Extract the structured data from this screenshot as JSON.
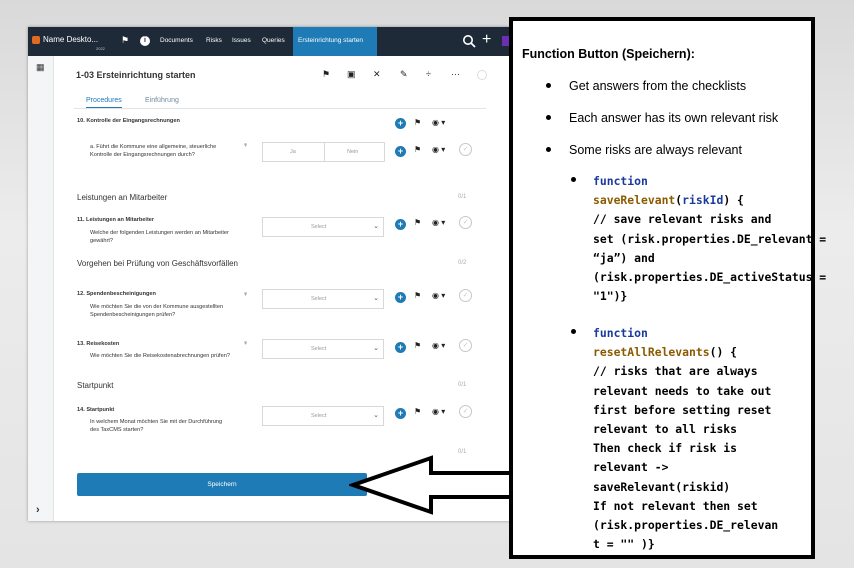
{
  "app": {
    "name": "Name Deskto...",
    "year": "2022",
    "nav": [
      "Documents",
      "Risks",
      "Issues",
      "Queries"
    ],
    "active_tab": "Ersteinrichtung starten"
  },
  "page": {
    "title": "1-03 Ersteinrichtung starten",
    "tabs": [
      "Procedures",
      "Einführung"
    ]
  },
  "questions": {
    "q10": {
      "title": "10. Kontrolle der Eingangsrechnungen"
    },
    "q10a": {
      "text": "a.  Führt die Kommune eine allgemeine, steuerliche Kontrolle der Eingangsrechnungen durch?",
      "yes": "Ja",
      "no": "Nein"
    },
    "sec1": {
      "title": "Leistungen an Mitarbeiter",
      "count": "0/1"
    },
    "q11": {
      "title": "11. Leistungen an Mitarbeiter",
      "text": "Welche der folgenden Leistungen werden an Mitarbeiter gewährt?",
      "select": "Select"
    },
    "sec2": {
      "title": "Vorgehen bei Prüfung von Geschäftsvorfällen",
      "count": "0/2"
    },
    "q12": {
      "title": "12. Spendenbescheinigungen",
      "text": "Wie möchten Sie die von der Kommune ausgestellten Spendenbescheinigungen prüfen?",
      "select": "Select"
    },
    "q13": {
      "title": "13. Reisekosten",
      "text": "Wie möchten Sie die Reisekostenabrechnungen prüfen?",
      "select": "Select"
    },
    "sec3": {
      "title": "Startpunkt",
      "count": "0/1"
    },
    "q14": {
      "title": "14. Startpunkt",
      "text": "In welchem Monat möchten Sie mit der Durchführung des TaxCMS starten?",
      "select": "Select"
    },
    "tail_count": "0/1"
  },
  "save_button": "Speichern",
  "callout": {
    "title": "Function Button (Speichern):",
    "bullets": [
      "Get answers from the checklists",
      "Each answer has its own relevant risk",
      "Some risks are always relevant"
    ],
    "code1": {
      "keyword": "function",
      "name": "saveRelevant",
      "param": "riskId",
      "body": "// save relevant risks and\nset (risk.properties.DE_relevant =\n“ja”) and\n(risk.properties.DE_activeStatus =\n\"1\")}"
    },
    "code2": {
      "keyword": "function",
      "name": "resetAllRelevants",
      "body": "// risks that are always\nrelevant needs to take out\nfirst before setting reset\nrelevant to all risks\nThen check if risk is\nrelevant ->\nsaveRelevant(riskid)\nIf not relevant then set\n(risk.properties.DE_relevan\nt = \"\" )}"
    }
  }
}
